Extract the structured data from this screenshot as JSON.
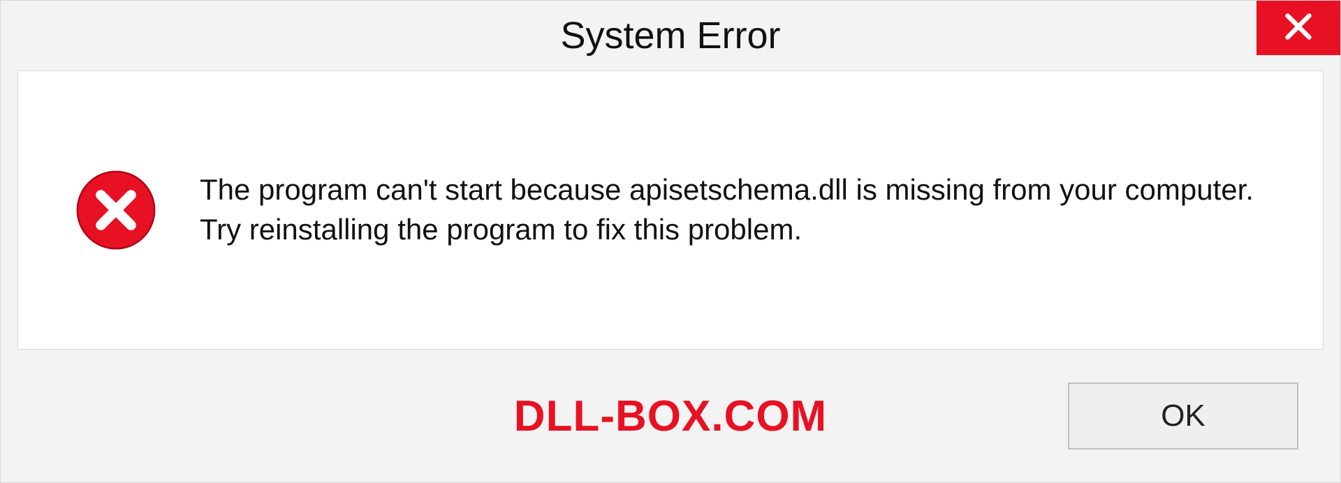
{
  "dialog": {
    "title": "System Error",
    "message": "The program can't start because apisetschema.dll is missing from your computer. Try reinstalling the program to fix this problem.",
    "ok_label": "OK"
  },
  "watermark": "DLL-BOX.COM"
}
